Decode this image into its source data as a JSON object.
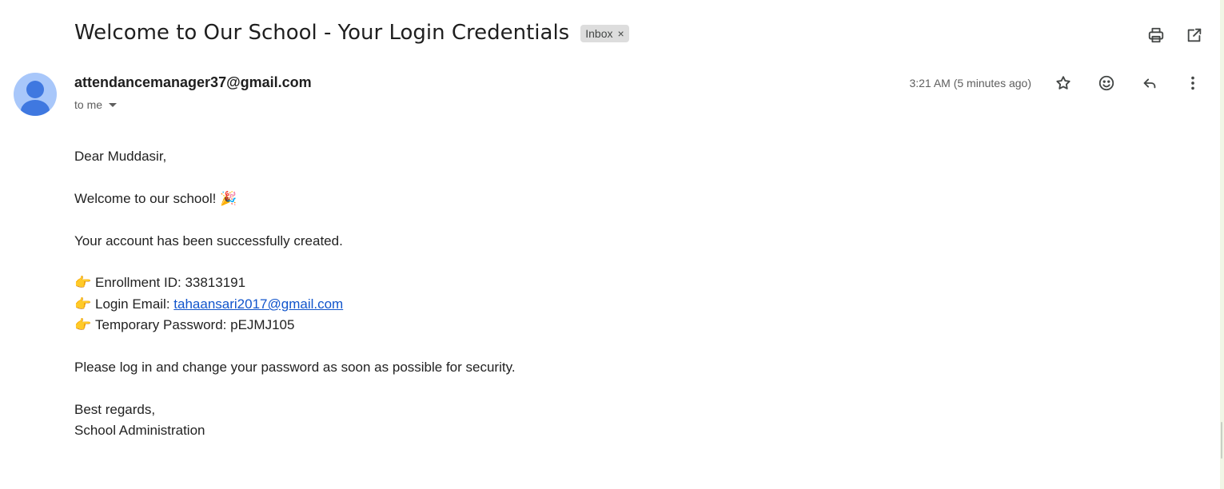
{
  "email": {
    "subject": "Welcome to Our School - Your Login Credentials",
    "label": "Inbox",
    "label_remove": "×",
    "sender": "attendancemanager37@gmail.com",
    "recipient_summary": "to me",
    "timestamp": "3:21 AM (5 minutes ago)"
  },
  "body": {
    "greeting": "Dear Muddasir,",
    "welcome": "Welcome to our school! 🎉",
    "created": "Your account has been successfully created.",
    "pointer_glyph": "👉",
    "enrollment_label": "Enrollment ID: ",
    "enrollment_value": "33813191",
    "login_label": "Login Email: ",
    "login_email": "tahaansari2017@gmail.com",
    "password_label": "Temporary Password: ",
    "password_value": "pEJMJ105",
    "instruction": "Please log in and change your password as soon as possible for security.",
    "closing": "Best regards,",
    "signature": "School Administration"
  },
  "icons": {
    "header": [
      "print-icon",
      "open-in-new-window-icon"
    ],
    "sender_row": [
      "star-icon",
      "emoji-reaction-icon",
      "reply-icon",
      "more-vert-icon"
    ]
  },
  "colors": {
    "avatar_bg": "#a8c7fa",
    "avatar_fg": "#3f78e0",
    "link": "#1155cc",
    "chip_bg": "#dddddd"
  }
}
